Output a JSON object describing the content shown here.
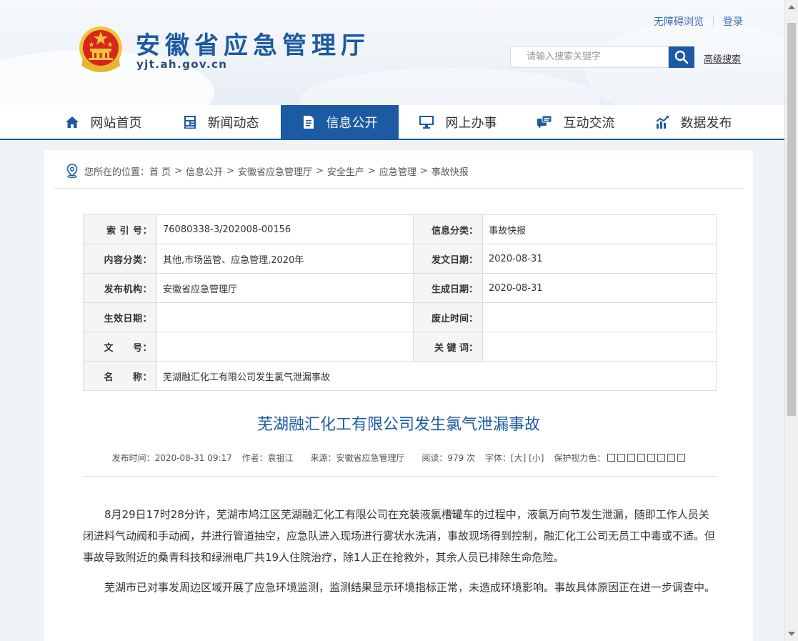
{
  "header": {
    "site_title": "安徽省应急管理厅",
    "site_domain": "yjt.ah.gov.cn",
    "accessibility_link": "无障碍浏览",
    "login_link": "登录",
    "search_placeholder": "请输入搜索关键字",
    "advanced_search": "高级搜索",
    "icons": [
      "national-emblem-icon",
      "search-icon"
    ]
  },
  "nav": {
    "items": [
      {
        "label": "网站首页",
        "icon": "home-icon",
        "active": false
      },
      {
        "label": "新闻动态",
        "icon": "news-icon",
        "active": false
      },
      {
        "label": "信息公开",
        "icon": "document-icon",
        "active": true
      },
      {
        "label": "网上办事",
        "icon": "monitor-icon",
        "active": false
      },
      {
        "label": "互动交流",
        "icon": "chat-icon",
        "active": false
      },
      {
        "label": "数据发布",
        "icon": "chart-icon",
        "active": false
      }
    ]
  },
  "breadcrumb": {
    "prefix": "您所在的位置：",
    "items": [
      "首 页",
      "信息公开",
      "安徽省应急管理厅",
      "安全生产",
      "应急管理",
      "事故快报"
    ],
    "separator": ">"
  },
  "meta": {
    "rows": [
      {
        "label1": "索 引 号：",
        "value1": "76080338-3/202008-00156",
        "label2": "信息分类：",
        "value2": "事故快报"
      },
      {
        "label1": "内容分类：",
        "value1": "其他,市场监管、应急管理,2020年",
        "label2": "发文日期：",
        "value2": "2020-08-31"
      },
      {
        "label1": "发布机构：",
        "value1": "安徽省应急管理厅",
        "label2": "生成日期：",
        "value2": "2020-08-31"
      },
      {
        "label1": "生效日期：",
        "value1": "",
        "label2": "废止时间：",
        "value2": ""
      },
      {
        "label1": "文　　号：",
        "value1": "",
        "label2": "关 键 词：",
        "value2": ""
      }
    ],
    "name_label": "名　　称：",
    "name_value": "芜湖融汇化工有限公司发生氯气泄漏事故"
  },
  "article": {
    "title": "芜湖融汇化工有限公司发生氯气泄漏事故",
    "publish_time": "发布时间：2020-08-31 09:17",
    "author": "作者：袁祖江",
    "source": "来源：安徽省应急管理厅",
    "views": "阅读：979 次",
    "font_size_label": "字体：",
    "font_large": "[大]",
    "font_small": "[小]",
    "eye_protect_label": "保护视力色：",
    "paragraphs": [
      "8月29日17时28分许，芜湖市鸠江区芜湖融汇化工有限公司在充装液氯槽罐车的过程中，液氯万向节发生泄漏，随即工作人员关闭进料气动阀和手动阀，并进行管道抽空，应急队进入现场进行雾状水洗消，事故现场得到控制，融汇化工公司无员工中毒或不适。但事故导致附近的桑青科技和绿洲电厂共19人住院治疗，除1人正在抢救外，其余人员已排除生命危险。",
      "芜湖市已对事发周边区域开展了应急环境监测，监测结果显示环境指标正常，未造成环境影响。事故具体原因正在进一步调查中。"
    ]
  },
  "colors": {
    "brand_blue": "#1c5aa3",
    "emblem_red": "#d7261c",
    "emblem_gold": "#f2c43b"
  }
}
